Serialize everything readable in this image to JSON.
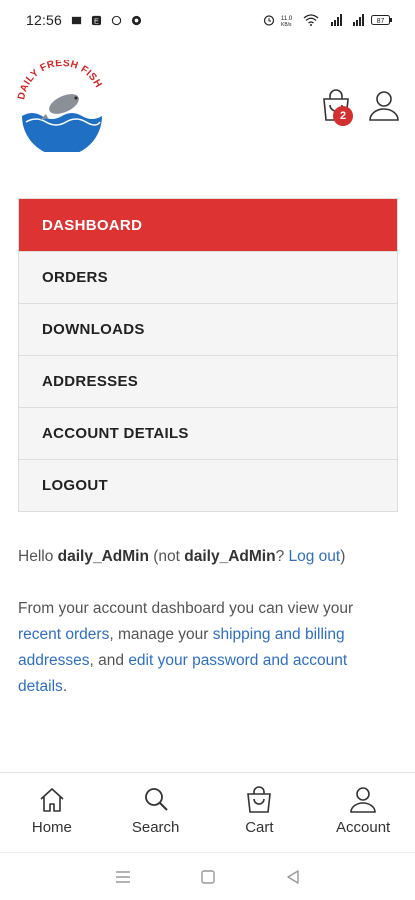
{
  "status_bar": {
    "time": "12:56",
    "network_speed": "11.0\nKB/s",
    "battery": "87"
  },
  "header": {
    "logo_text": "DAILY FRESH FISH",
    "cart_count": "2"
  },
  "account_menu": {
    "items": [
      {
        "label": "DASHBOARD",
        "active": true
      },
      {
        "label": "ORDERS",
        "active": false
      },
      {
        "label": "DOWNLOADS",
        "active": false
      },
      {
        "label": "ADDRESSES",
        "active": false
      },
      {
        "label": "ACCOUNT DETAILS",
        "active": false
      },
      {
        "label": "LOGOUT",
        "active": false
      }
    ]
  },
  "dashboard": {
    "hello": "Hello",
    "username": "daily_AdMin",
    "not_prefix": "(not",
    "not_username": "daily_AdMin",
    "question": "?",
    "logout_link": "Log out",
    "close_paren": ")",
    "intro_text": "From your account dashboard you can view your",
    "recent_orders_link": "recent orders",
    "manage_text": ", manage your",
    "addresses_link": "shipping and billing addresses",
    "and_text": ", and",
    "edit_link": "edit your password and account details",
    "period": "."
  },
  "bottom_nav": {
    "home": "Home",
    "search": "Search",
    "cart": "Cart",
    "account": "Account"
  },
  "colors": {
    "accent": "#dd3333",
    "link": "#2f6fc2",
    "badge": "#d32f2f"
  }
}
